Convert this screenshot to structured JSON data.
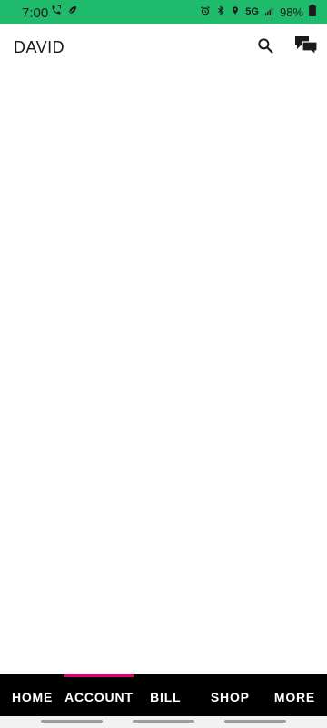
{
  "status_bar": {
    "time": "7:00",
    "network": "5G",
    "battery": "98%",
    "icons": [
      "phone-call-icon",
      "leaf-icon",
      "alarm-icon",
      "bluetooth-icon",
      "location-icon",
      "signal-icon",
      "battery-icon"
    ],
    "background_color": "#1fba6b"
  },
  "app_bar": {
    "title": "DAVID",
    "actions": [
      "search-icon",
      "messages-icon"
    ]
  },
  "bottom_nav": {
    "tabs": [
      {
        "label": "HOME",
        "active": false
      },
      {
        "label": "ACCOUNT",
        "active": true
      },
      {
        "label": "BILL",
        "active": false
      },
      {
        "label": "SHOP",
        "active": false
      },
      {
        "label": "MORE",
        "active": false
      }
    ],
    "active_color": "#e20074"
  }
}
